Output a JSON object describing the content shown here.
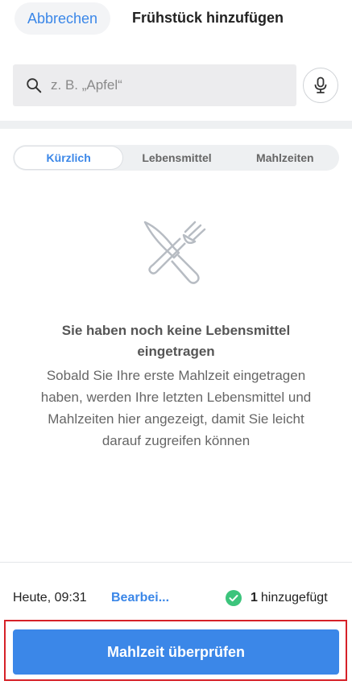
{
  "header": {
    "cancel_label": "Abbrechen",
    "title": "Frühstück hinzufügen"
  },
  "search": {
    "placeholder": "z. B. „Apfel“",
    "icon": "search-icon",
    "mic_icon": "microphone-icon"
  },
  "tabs": [
    {
      "label": "Kürzlich",
      "active": true
    },
    {
      "label": "Lebensmittel",
      "active": false
    },
    {
      "label": "Mahlzeiten",
      "active": false
    }
  ],
  "empty_state": {
    "icon": "knife-fork-icon",
    "title": "Sie haben noch keine Lebensmittel eingetragen",
    "description": "Sobald Sie Ihre erste Mahlzeit eingetragen haben, werden Ihre letzten Lebensmittel und Mahlzeiten hier angezeigt, damit Sie leicht darauf zugreifen können"
  },
  "footer": {
    "time": "Heute, 09:31",
    "edit_label": "Bearbei...",
    "added_count": "1",
    "added_label": "hinzugefügt"
  },
  "cta": {
    "label": "Mahlzeit überprüfen"
  },
  "colors": {
    "accent": "#3b87e8",
    "highlight_frame": "#d62128",
    "success": "#3cc47c"
  }
}
